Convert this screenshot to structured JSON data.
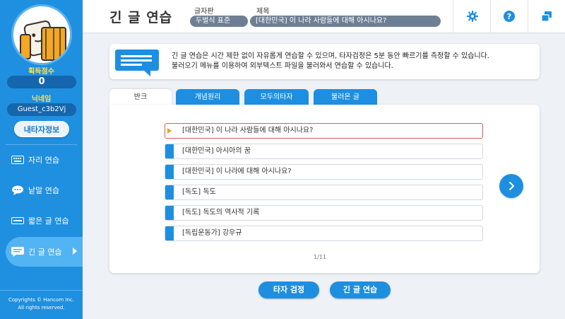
{
  "sidebar": {
    "score_label": "획득점수",
    "score_value": "0",
    "nickname_label": "닉네임",
    "nickname_value": "Guest_c3b2Vj",
    "info_button": "내타자정보",
    "nav": [
      {
        "label": "자리 연습",
        "icon": "keyboard-icon"
      },
      {
        "label": "낱말 연습",
        "icon": "speech-bubble-icon"
      },
      {
        "label": "짧은 글 연습",
        "icon": "short-text-icon"
      },
      {
        "label": "긴 글 연습",
        "icon": "long-text-icon",
        "active": true
      }
    ],
    "copyright_line1": "Copyrights © Hancom Inc.",
    "copyright_line2": "All rights reserved."
  },
  "header": {
    "title": "긴 글 연습",
    "keyboard_label": "글자판",
    "keyboard_value": "두벌식 표준",
    "subject_label": "제목",
    "subject_value": "[대한민국] 이 나라 사람들에 대해 아시나요?",
    "icons": [
      "gear-icon",
      "help-icon",
      "window-icon"
    ]
  },
  "info": {
    "line1": "긴 글 연습은 시간 제한 없이 자유롭게 연습할 수 있으며, 타자검정은 5분 동안 빠르기를 측정할 수 있습니다.",
    "line2": "불러오기 메뉴를 이용하여 외부텍스트 파일을 불러와서 연습할 수 있습니다."
  },
  "tabs": [
    "반크",
    "개념원리",
    "모두의타자",
    "불러온 글"
  ],
  "list": [
    "[대한민국] 이 나라 사람들에 대해 아시나요?",
    "[대한민국] 아시아의 꿈",
    "[대한민국] 이 나라에 대해 아시나요?",
    "[독도] 독도",
    "[독도] 독도의 역사적 기록",
    "[독립운동가] 강우규"
  ],
  "pager": "1/11",
  "buttons": {
    "test": "타자 검정",
    "practice": "긴 글 연습"
  },
  "colors": {
    "primary": "#1e8fe0",
    "sidebar": "#1f8fe0",
    "accent_yellow": "#ffe14d",
    "selected_border": "#e05a5a"
  }
}
